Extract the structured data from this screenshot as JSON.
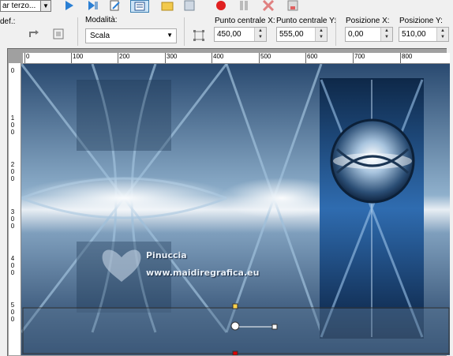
{
  "toolbar": {
    "preset_value": "ar terzo...",
    "preset_label": "def.:"
  },
  "options": {
    "mode_label": "Modalità:",
    "mode_value": "Scala",
    "cx_label": "Punto centrale X:",
    "cx_value": "450,00",
    "cy_label": "Punto centrale Y:",
    "cy_value": "555,00",
    "px_label": "Posizione X:",
    "px_value": "0,00",
    "py_label": "Posizione Y:",
    "py_value": "510,00"
  },
  "ruler": {
    "h_labels": [
      "0",
      "100",
      "200",
      "300",
      "400",
      "500",
      "600",
      "700",
      "800"
    ],
    "v_labels": [
      "0",
      "1",
      "0",
      "0",
      "2",
      "0",
      "0",
      "3",
      "0",
      "0",
      "4",
      "0",
      "0",
      "5",
      "0",
      "0"
    ]
  },
  "watermark": {
    "name": "Pinuccia",
    "site": "www.maidiregrafica.eu"
  },
  "colors": {
    "accent_blue": "#1f6fc2",
    "selection": "#cce4f7",
    "record_red": "#e02020"
  }
}
